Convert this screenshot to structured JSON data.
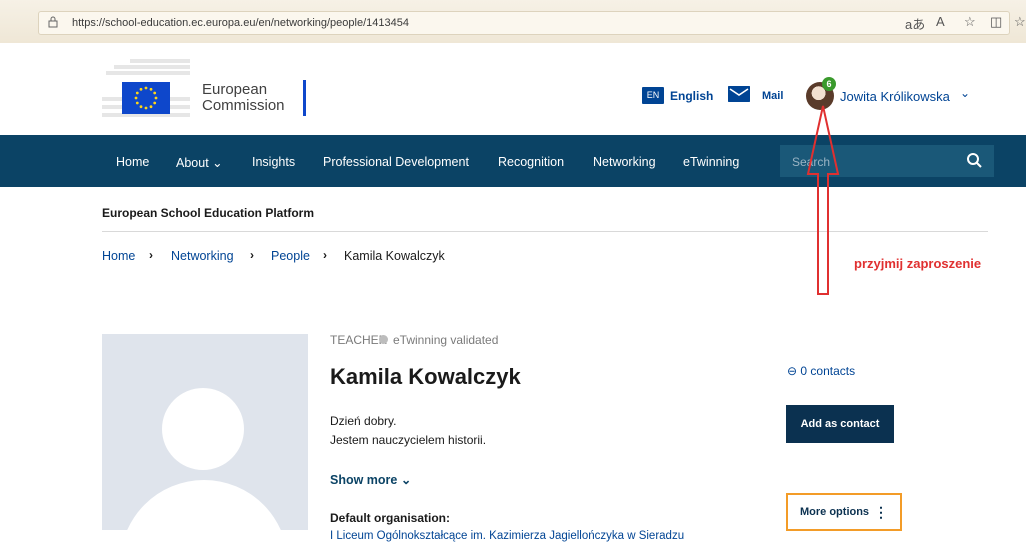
{
  "browser": {
    "url": "https://school-education.ec.europa.eu/en/networking/people/1413454",
    "icons": [
      "read-aloud-icon",
      "translate-icon",
      "favorite-star-icon",
      "split-screen-icon",
      "favorites-icon"
    ]
  },
  "header": {
    "logo_line1": "European",
    "logo_line2": "Commission",
    "lang_code": "EN",
    "lang_label": "English",
    "mail_label": "Mail",
    "notification_count": "6",
    "user_name": "Jowita Królikowska"
  },
  "nav": {
    "items": [
      {
        "label": "Home"
      },
      {
        "label": "About"
      },
      {
        "label": "Insights"
      },
      {
        "label": "Professional Development"
      },
      {
        "label": "Recognition"
      },
      {
        "label": "Networking"
      },
      {
        "label": "eTwinning"
      }
    ],
    "search_placeholder": "Search"
  },
  "platform_title": "European School Education Platform",
  "breadcrumb": [
    {
      "label": "Home"
    },
    {
      "label": "Networking"
    },
    {
      "label": "People"
    },
    {
      "label": "Kamila Kowalczyk"
    }
  ],
  "annotation": {
    "text": "przyjmij zaproszenie",
    "color": "#e03030"
  },
  "profile": {
    "role": "TEACHER",
    "validated": "eTwinning validated",
    "name": "Kamila Kowalczyk",
    "bio_lines": [
      "Dzień dobry.",
      "Jestem nauczycielem historii."
    ],
    "show_more": "Show more",
    "org_label": "Default organisation:",
    "org_value": "I Liceum Ogólnokształcące im. Kazimierza Jagiellończyka w Sieradzu",
    "contacts": "0 contacts",
    "add_contact": "Add as contact",
    "more_options": "More options"
  },
  "colors": {
    "nav_bg": "#0b4365",
    "brand_blue": "#004494",
    "button_dark": "#0b3150",
    "focus_orange": "#f39c28"
  }
}
